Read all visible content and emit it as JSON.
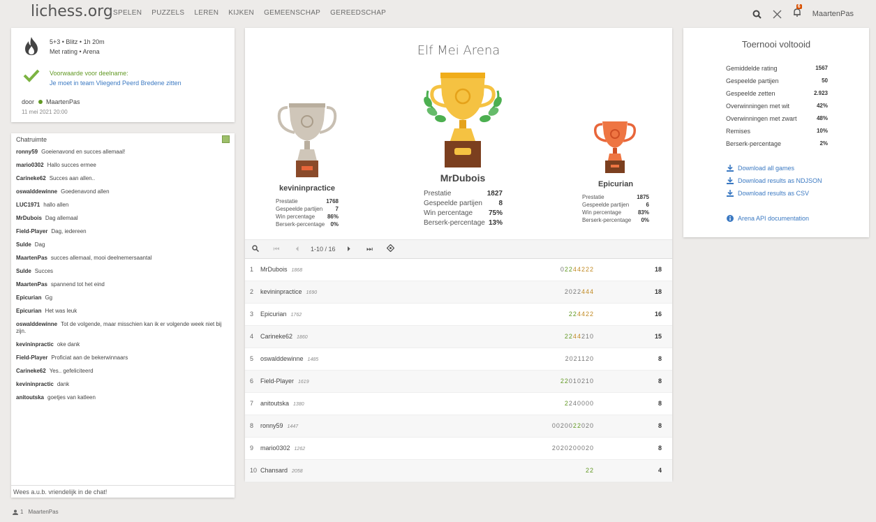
{
  "header": {
    "logo": "lichess.org",
    "nav": [
      "SPELEN",
      "PUZZELS",
      "LEREN",
      "KIJKEN",
      "GEMEENSCHAP",
      "GEREEDSCHAP"
    ],
    "notification_count": "6",
    "username": "MaartenPas"
  },
  "info": {
    "line1": "5+3 • Blitz • 1h 20m",
    "line2": "Met rating • Arena",
    "cond_title": "Voorwaarde voor deelname:",
    "cond_text": "Je moet in team Vliegend Peerd Bredene zitten",
    "by_label": "door",
    "by_user": "MaartenPas",
    "date": "11 mei 2021 20:00"
  },
  "chat": {
    "title": "Chatruimte",
    "placeholder": "Wees a.u.b. vriendelijk in de chat!",
    "messages": [
      {
        "user": "ronny59",
        "text": "Goeienavond en succes allemaal!"
      },
      {
        "user": "mario0302",
        "text": "Hallo succes ermee"
      },
      {
        "user": "Carineke62",
        "text": "Succes aan allen.."
      },
      {
        "user": "oswalddewinne",
        "text": "Goedenavond allen"
      },
      {
        "user": "LUC1971",
        "text": "hallo allen"
      },
      {
        "user": "MrDubois",
        "text": "Dag allemaal"
      },
      {
        "user": "Field-Player",
        "text": "Dag, iedereen"
      },
      {
        "user": "Sulde",
        "text": "Dag"
      },
      {
        "user": "MaartenPas",
        "text": "succes allemaal, mooi deelnemersaantal"
      },
      {
        "user": "Sulde",
        "text": "Succes"
      },
      {
        "user": "MaartenPas",
        "text": "spannend tot het eind"
      },
      {
        "user": "Epicurian",
        "text": "Gg"
      },
      {
        "user": "Epicurian",
        "text": "Het was leuk"
      },
      {
        "user": "oswalddewinne",
        "text": "Tot de volgende, maar misschien kan ik er volgende week niet bij zijn."
      },
      {
        "user": "kevininpractic",
        "text": "oke dank"
      },
      {
        "user": "Field-Player",
        "text": "Proficiat aan de bekerwinnaars"
      },
      {
        "user": "Carineke62",
        "text": "Yes.. gefeliciteerd"
      },
      {
        "user": "kevininpractic",
        "text": "dank"
      },
      {
        "user": "anitoutska",
        "text": "goetjes van katleen"
      }
    ]
  },
  "footer": {
    "count": "1",
    "user": "MaartenPas"
  },
  "tournament": {
    "title": "Elf Mei Arena",
    "podium": {
      "first": {
        "name": "MrDubois",
        "stats": [
          [
            "Prestatie",
            "1827"
          ],
          [
            "Gespeelde partijen",
            "8"
          ],
          [
            "Win percentage",
            "75%"
          ],
          [
            "Berserk-percentage",
            "13%"
          ]
        ]
      },
      "second": {
        "name": "kevininpractice",
        "stats": [
          [
            "Prestatie",
            "1768"
          ],
          [
            "Gespeelde partijen",
            "7"
          ],
          [
            "Win percentage",
            "86%"
          ],
          [
            "Berserk-percentage",
            "0%"
          ]
        ]
      },
      "third": {
        "name": "Epicurian",
        "stats": [
          [
            "Prestatie",
            "1875"
          ],
          [
            "Gespeelde partijen",
            "6"
          ],
          [
            "Win percentage",
            "83%"
          ],
          [
            "Berserk-percentage",
            "0%"
          ]
        ]
      }
    },
    "pager_label": "1-10 / 16",
    "standings": [
      {
        "rank": "1",
        "name": "MrDubois",
        "rating": "1868",
        "scores": [
          [
            "0",
            "n"
          ],
          [
            "2",
            "g"
          ],
          [
            "2",
            "g"
          ],
          [
            "4",
            "o"
          ],
          [
            "4",
            "o"
          ],
          [
            "2",
            "o"
          ],
          [
            "2",
            "o"
          ],
          [
            "2",
            "o"
          ]
        ],
        "total": "18"
      },
      {
        "rank": "2",
        "name": "kevininpractice",
        "rating": "1690",
        "scores": [
          [
            "2",
            "n"
          ],
          [
            "0",
            "n"
          ],
          [
            "2",
            "n"
          ],
          [
            "2",
            "n"
          ],
          [
            "4",
            "o"
          ],
          [
            "4",
            "o"
          ],
          [
            "4",
            "o"
          ]
        ],
        "total": "18"
      },
      {
        "rank": "3",
        "name": "Epicurian",
        "rating": "1762",
        "scores": [
          [
            "2",
            "g"
          ],
          [
            "2",
            "g"
          ],
          [
            "4",
            "o"
          ],
          [
            "4",
            "o"
          ],
          [
            "2",
            "o"
          ],
          [
            "2",
            "o"
          ]
        ],
        "total": "16"
      },
      {
        "rank": "4",
        "name": "Carineke62",
        "rating": "1860",
        "scores": [
          [
            "2",
            "g"
          ],
          [
            "2",
            "g"
          ],
          [
            "4",
            "o"
          ],
          [
            "4",
            "o"
          ],
          [
            "2",
            "n"
          ],
          [
            "1",
            "n"
          ],
          [
            "0",
            "n"
          ]
        ],
        "total": "15"
      },
      {
        "rank": "5",
        "name": "oswalddewinne",
        "rating": "1485",
        "scores": [
          [
            "2",
            "n"
          ],
          [
            "0",
            "n"
          ],
          [
            "2",
            "n"
          ],
          [
            "1",
            "n"
          ],
          [
            "1",
            "n"
          ],
          [
            "2",
            "n"
          ],
          [
            "0",
            "n"
          ]
        ],
        "total": "8"
      },
      {
        "rank": "6",
        "name": "Field-Player",
        "rating": "1619",
        "scores": [
          [
            "2",
            "g"
          ],
          [
            "2",
            "g"
          ],
          [
            "0",
            "n"
          ],
          [
            "1",
            "n"
          ],
          [
            "0",
            "n"
          ],
          [
            "2",
            "n"
          ],
          [
            "1",
            "n"
          ],
          [
            "0",
            "n"
          ]
        ],
        "total": "8"
      },
      {
        "rank": "7",
        "name": "anitoutska",
        "rating": "1380",
        "scores": [
          [
            "2",
            "g"
          ],
          [
            "2",
            "n"
          ],
          [
            "4",
            "n"
          ],
          [
            "0",
            "n"
          ],
          [
            "0",
            "n"
          ],
          [
            "0",
            "n"
          ],
          [
            "0",
            "n"
          ]
        ],
        "total": "8"
      },
      {
        "rank": "8",
        "name": "ronny59",
        "rating": "1447",
        "scores": [
          [
            "0",
            "n"
          ],
          [
            "0",
            "n"
          ],
          [
            "2",
            "n"
          ],
          [
            "0",
            "n"
          ],
          [
            "0",
            "n"
          ],
          [
            "2",
            "g"
          ],
          [
            "2",
            "g"
          ],
          [
            "0",
            "n"
          ],
          [
            "2",
            "n"
          ],
          [
            "0",
            "n"
          ]
        ],
        "total": "8"
      },
      {
        "rank": "9",
        "name": "mario0302",
        "rating": "1262",
        "scores": [
          [
            "2",
            "n"
          ],
          [
            "0",
            "n"
          ],
          [
            "2",
            "n"
          ],
          [
            "0",
            "n"
          ],
          [
            "2",
            "n"
          ],
          [
            "0",
            "n"
          ],
          [
            "0",
            "n"
          ],
          [
            "0",
            "n"
          ],
          [
            "2",
            "n"
          ],
          [
            "0",
            "n"
          ]
        ],
        "total": "8"
      },
      {
        "rank": "10",
        "name": "Chansard",
        "rating": "2058",
        "scores": [
          [
            "2",
            "g"
          ],
          [
            "2",
            "g"
          ]
        ],
        "total": "4"
      }
    ]
  },
  "stats": {
    "title": "Toernooi voltooid",
    "rows": [
      [
        "Gemiddelde rating",
        "1567"
      ],
      [
        "Gespeelde partijen",
        "50"
      ],
      [
        "Gespeelde zetten",
        "2.923"
      ],
      [
        "Overwinningen met wit",
        "42%"
      ],
      [
        "Overwinningen met zwart",
        "48%"
      ],
      [
        "Remises",
        "10%"
      ],
      [
        "Berserk-percentage",
        "2%"
      ]
    ],
    "downloads": [
      "Download all games",
      "Download results as NDJSON",
      "Download results as CSV"
    ],
    "api": "Arena API documentation"
  },
  "colors": {
    "green": "#629924",
    "blue": "#3b79c2",
    "orange": "#c18a23",
    "gold": "#f5c242",
    "silver": "#c8bfb2",
    "bronze": "#e8663a"
  }
}
